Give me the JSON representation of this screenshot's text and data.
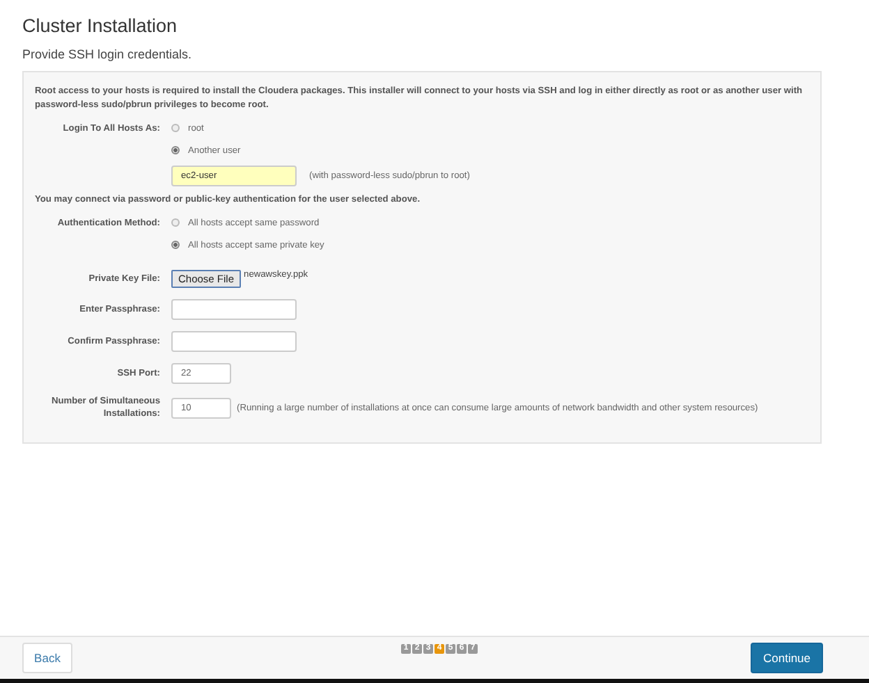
{
  "title": "Cluster Installation",
  "subtitle": "Provide SSH login credentials.",
  "panel": {
    "intro": "Root access to your hosts is required to install the Cloudera packages. This installer will connect to your hosts via SSH and log in either directly as root or as another user with password-less sudo/pbrun privileges to become root.",
    "login": {
      "label": "Login To All Hosts As:",
      "options": [
        {
          "label": "root",
          "selected": false
        },
        {
          "label": "Another user",
          "selected": true
        }
      ],
      "user": {
        "value": "ec2-user",
        "hint": "(with password-less sudo/pbrun to root)"
      }
    },
    "auth_note": "You may connect via password or public-key authentication for the user selected above.",
    "auth": {
      "label": "Authentication Method:",
      "options": [
        {
          "label": "All hosts accept same password",
          "selected": false
        },
        {
          "label": "All hosts accept same private key",
          "selected": true
        }
      ]
    },
    "fields": [
      {
        "kind": "file",
        "label": "Private Key File:",
        "button": "Choose File",
        "filename": "newawskey.ppk"
      },
      {
        "kind": "password",
        "label": "Enter Passphrase:"
      },
      {
        "kind": "password",
        "label": "Confirm Passphrase:"
      },
      {
        "kind": "short",
        "label": "SSH Port:",
        "value": "22"
      },
      {
        "kind": "short",
        "label": "Number of Simultaneous Installations:",
        "value": "10",
        "note": "(Running a large number of installations at once can consume large amounts of network bandwidth and other system resources)"
      }
    ]
  },
  "footer": {
    "back": "Back",
    "steps": [
      {
        "label": "1",
        "selected": false
      },
      {
        "label": "2",
        "selected": false
      },
      {
        "label": "3",
        "selected": false
      },
      {
        "label": "4",
        "selected": true
      },
      {
        "label": "5",
        "selected": false
      },
      {
        "label": "6",
        "selected": false
      },
      {
        "label": "7",
        "selected": false
      }
    ],
    "continue": "Continue"
  }
}
